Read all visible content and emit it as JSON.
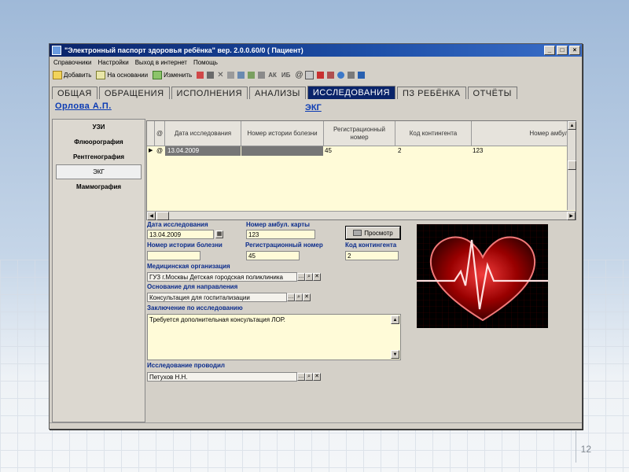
{
  "slide": {
    "page_number": "12"
  },
  "window": {
    "title": "\"Электронный паспорт здоровья ребёнка\" вер. 2.0.0.60/0 ( Пациент)",
    "controls": {
      "minimize": "_",
      "maximize": "□",
      "close": "×"
    }
  },
  "menu": [
    "Справочники",
    "Настройки",
    "Выход в интернет",
    "Помощь"
  ],
  "toolbar": {
    "add_label": "Добавить",
    "based_on_label": "На основании",
    "edit_label": "Изменить",
    "ak_label": "АК",
    "ib_label": "ИБ"
  },
  "tabs": [
    "ОБЩАЯ",
    "ОБРАЩЕНИЯ",
    "ИСПОЛНЕНИЯ",
    "АНАЛИЗЫ",
    "ИССЛЕДОВАНИЯ",
    "ПЗ РЕБЁНКА",
    "ОТЧЁТЫ"
  ],
  "active_tab": "ИССЛЕДОВАНИЯ",
  "patient_name": "Орлова А.П.",
  "section_title": "ЭКГ",
  "nav": {
    "items": [
      "УЗИ",
      "Флюорография",
      "Рентгенография",
      "ЭКГ",
      "Маммография"
    ],
    "selected": "ЭКГ"
  },
  "grid": {
    "columns": [
      "Дата исследования",
      "Номер истории болезни",
      "Регистрационный номер",
      "Код контингента",
      "Номер амбул"
    ],
    "rows": [
      {
        "date": "13.04.2009",
        "history_no": "",
        "reg_no": "45",
        "contingent": "2",
        "amb_no": "123"
      }
    ]
  },
  "form": {
    "date_label": "Дата исследования",
    "date_value": "13.04.2009",
    "amb_card_label": "Номер амбул. карты",
    "amb_card_value": "123",
    "view_button": "Просмотр",
    "history_label": "Номер истории болезни",
    "history_value": "",
    "reg_label": "Регистрационный номер",
    "reg_value": "45",
    "contingent_label": "Код контингента",
    "contingent_value": "2",
    "org_label": "Медицинская организация",
    "org_value": "ГУЗ г.Москвы Детская городская поликлиника",
    "basis_label": "Основание для направления",
    "basis_value": "Консультация для госпитализации",
    "conclusion_label": "Заключение по исследованию",
    "conclusion_value": "Требуется дополнительная консультация ЛОР.",
    "performer_label": "Исследование проводил",
    "performer_value": "Петухов Н.Н."
  }
}
